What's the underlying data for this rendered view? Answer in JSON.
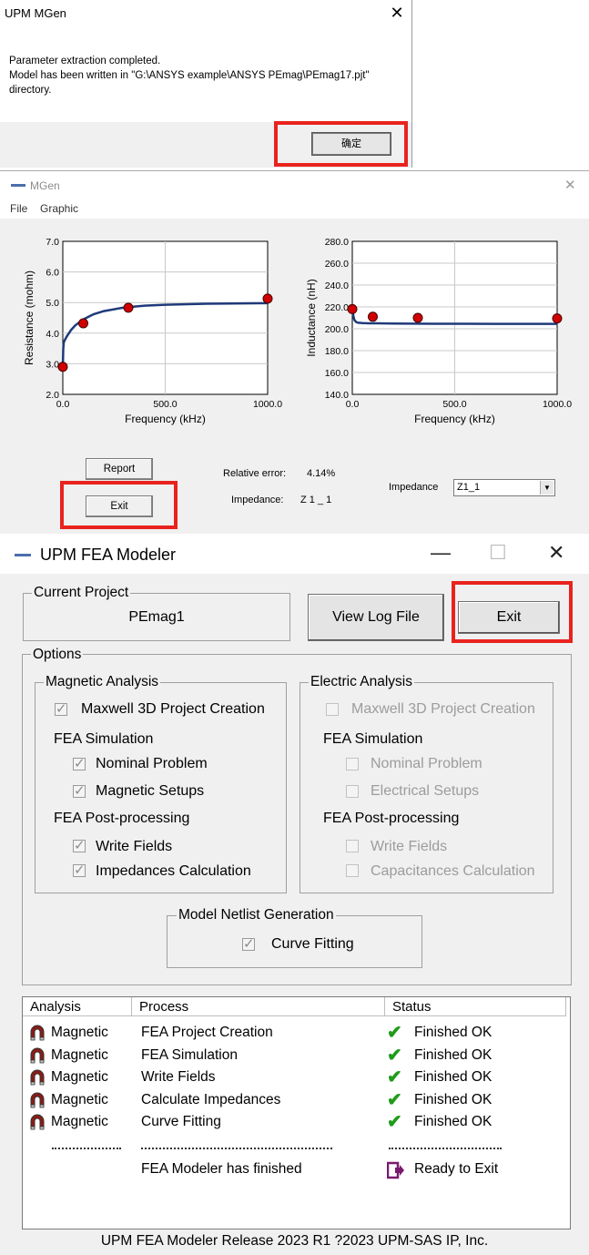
{
  "dialog": {
    "title": "UPM MGen",
    "close_glyph": "✕",
    "message_line1": "Parameter extraction completed.",
    "message_line2": "Model has been written in \"G:\\ANSYS example\\ANSYS PEmag\\PEmag17.pjt\"",
    "message_line3": "directory.",
    "ok_label": "确定"
  },
  "mgen": {
    "title": "MGen",
    "close_glyph": "✕",
    "menu": [
      "File",
      "Graphic"
    ],
    "report_label": "Report",
    "exit_label": "Exit",
    "relative_error_label": "Relative error:",
    "relative_error_value": "4.14%",
    "impedance_label": "Impedance:",
    "impedance_value": "Z 1 _ 1",
    "impedance_select_label": "Impedance",
    "impedance_select_value": "Z1_1"
  },
  "chart_data": [
    {
      "type": "line",
      "xlabel": "Frequency (kHz)",
      "ylabel": "Resistance (mohm)",
      "xlim": [
        0,
        1000
      ],
      "ylim": [
        2.0,
        7.0
      ],
      "xticks": [
        "0.0",
        "500.0",
        "1000.0"
      ],
      "yticks": [
        "2.0",
        "3.0",
        "4.0",
        "5.0",
        "6.0",
        "7.0"
      ],
      "grid": true,
      "series": [
        {
          "kind": "fit-curve",
          "x": [
            0,
            2,
            5,
            10,
            20,
            40,
            60,
            100,
            150,
            200,
            300,
            400,
            500,
            700,
            1000
          ],
          "y": [
            2.9,
            3.5,
            3.7,
            3.78,
            3.9,
            4.1,
            4.25,
            4.45,
            4.62,
            4.72,
            4.84,
            4.9,
            4.93,
            4.96,
            4.98
          ]
        },
        {
          "kind": "measured-points",
          "x": [
            0,
            100,
            320,
            1000
          ],
          "y": [
            2.9,
            4.32,
            4.83,
            5.13
          ]
        }
      ]
    },
    {
      "type": "line",
      "xlabel": "Frequency (kHz)",
      "ylabel": "Inductance (nH)",
      "xlim": [
        0,
        1000
      ],
      "ylim": [
        140,
        280
      ],
      "xticks": [
        "0.0",
        "500.0",
        "1000.0"
      ],
      "yticks": [
        "140.0",
        "160.0",
        "180.0",
        "200.0",
        "220.0",
        "240.0",
        "260.0",
        "280.0"
      ],
      "grid": true,
      "series": [
        {
          "kind": "fit-curve",
          "x": [
            0,
            5,
            10,
            20,
            30,
            50,
            80,
            120,
            200,
            400,
            700,
            1000
          ],
          "y": [
            218,
            212,
            208,
            206,
            205.5,
            205.2,
            205,
            205,
            204.8,
            204.6,
            204.5,
            204.5
          ]
        },
        {
          "kind": "measured-points",
          "x": [
            0,
            100,
            320,
            1000
          ],
          "y": [
            218,
            211,
            210,
            209.5
          ]
        }
      ]
    }
  ],
  "fea": {
    "title": "UPM FEA Modeler",
    "minimize_glyph": "—",
    "maximize_glyph": "☐",
    "close_glyph": "✕",
    "current_project_label": "Current Project",
    "current_project_value": "PEmag1",
    "view_log_label": "View Log File",
    "exit_label": "Exit",
    "options_label": "Options",
    "magnetic": {
      "title": "Magnetic Analysis",
      "project_creation": "Maxwell 3D Project Creation",
      "fea_simulation": "FEA Simulation",
      "nominal_problem": "Nominal Problem",
      "setups": "Magnetic Setups",
      "post_processing": "FEA Post-processing",
      "write_fields": "Write Fields",
      "calc": "Impedances Calculation"
    },
    "electric": {
      "title": "Electric Analysis",
      "project_creation": "Maxwell 3D Project Creation",
      "fea_simulation": "FEA Simulation",
      "nominal_problem": "Nominal Problem",
      "setups": "Electrical Setups",
      "post_processing": "FEA Post-processing",
      "write_fields": "Write Fields",
      "calc": "Capacitances Calculation"
    },
    "netlist": {
      "title": "Model Netlist Generation",
      "curve_fitting": "Curve Fitting"
    },
    "table": {
      "headers": [
        "Analysis",
        "Process",
        "Status"
      ],
      "rows": [
        {
          "analysis": "Magnetic",
          "process": "FEA Project Creation",
          "status": "Finished OK"
        },
        {
          "analysis": "Magnetic",
          "process": "FEA Simulation",
          "status": "Finished OK"
        },
        {
          "analysis": "Magnetic",
          "process": "Write Fields",
          "status": "Finished OK"
        },
        {
          "analysis": "Magnetic",
          "process": "Calculate Impedances",
          "status": "Finished OK"
        },
        {
          "analysis": "Magnetic",
          "process": "Curve Fitting",
          "status": "Finished OK"
        }
      ],
      "final_process": "FEA Modeler has finished",
      "final_status": "Ready to Exit"
    },
    "footer": "UPM FEA Modeler Release 2023 R1 ?2023 UPM-SAS IP, Inc."
  },
  "colors": {
    "highlight": "#e8231e",
    "curve": "#1f3a7a",
    "point": "#d00000",
    "check": "#1f9c1a",
    "exit_icon": "#7a1a6e"
  }
}
